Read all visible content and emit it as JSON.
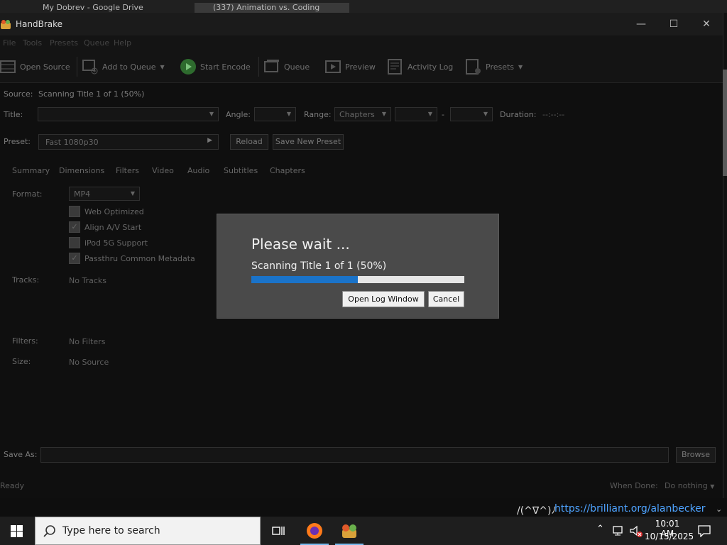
{
  "browser": {
    "tabs": [
      "My Dobrev - Google Drive",
      "(337) Animation vs. Coding"
    ]
  },
  "window": {
    "title": "HandBrake",
    "minimize": "—",
    "maximize": "☐",
    "close": "✕"
  },
  "menu": [
    "File",
    "Tools",
    "Presets",
    "Queue",
    "Help"
  ],
  "toolbar": {
    "open_source": "Open Source",
    "add_to_queue": "Add to Queue",
    "start_encode": "Start Encode",
    "queue": "Queue",
    "preview": "Preview",
    "activity_log": "Activity Log",
    "presets": "Presets"
  },
  "source": {
    "label": "Source:",
    "value": "Scanning Title 1 of 1 (50%)"
  },
  "title_row": {
    "title_label": "Title:",
    "angle_label": "Angle:",
    "range_label": "Range:",
    "range_value": "Chapters",
    "dash": "-",
    "duration_label": "Duration:",
    "duration_value": "--:--:--"
  },
  "preset_row": {
    "label": "Preset:",
    "value": "Fast 1080p30",
    "reload": "Reload",
    "save_new": "Save New Preset"
  },
  "tabs": [
    "Summary",
    "Dimensions",
    "Filters",
    "Video",
    "Audio",
    "Subtitles",
    "Chapters"
  ],
  "summary": {
    "format_label": "Format:",
    "format_value": "MP4",
    "checkboxes": [
      {
        "label": "Web Optimized",
        "checked": false
      },
      {
        "label": "Align A/V Start",
        "checked": true
      },
      {
        "label": "iPod 5G Support",
        "checked": false
      },
      {
        "label": "Passthru Common Metadata",
        "checked": true
      }
    ],
    "tracks_label": "Tracks:",
    "tracks_value": "No Tracks",
    "filters_label": "Filters:",
    "filters_value": "No Filters",
    "size_label": "Size:",
    "size_value": "No Source"
  },
  "save_as": {
    "label": "Save As:",
    "browse": "Browse"
  },
  "status": {
    "text": "Ready",
    "when_done_label": "When Done:",
    "when_done_value": "Do nothing"
  },
  "dialog": {
    "title": "Please wait ...",
    "status": "Scanning Title 1 of 1 (50%)",
    "progress": 0.5,
    "open_log": "Open Log Window",
    "cancel": "Cancel"
  },
  "background": {
    "emote": "/(^∇^)ﾉ",
    "link": "https://brilliant.org/alanbecker"
  },
  "taskbar": {
    "search_placeholder": "Type here to search",
    "time": "10:01 AM",
    "date": "10/15/2025"
  },
  "colors": {
    "progress": "#1a73c9",
    "dialog_bg": "#4a4a4a",
    "link": "#4ea3ff"
  }
}
